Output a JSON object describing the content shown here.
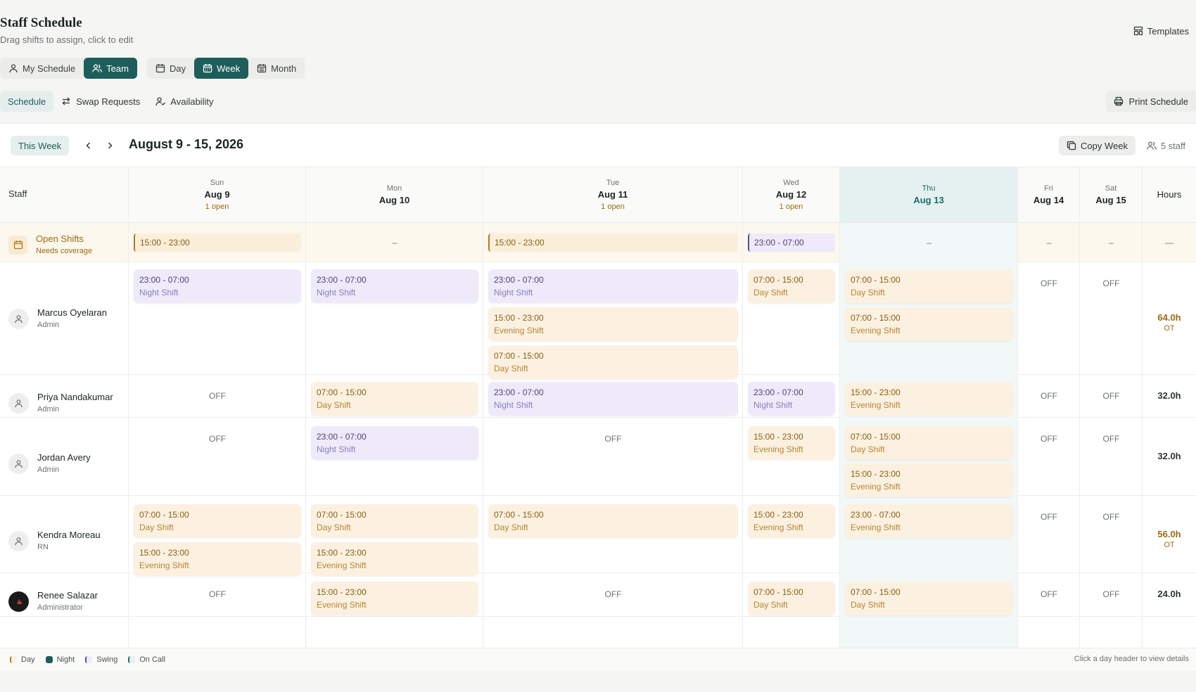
{
  "header": {
    "title": "Staff Schedule",
    "subtitle": "Drag shifts to assign, click to edit",
    "templates_label": "Templates"
  },
  "views": {
    "my_schedule": "My Schedule",
    "team": "Team",
    "day": "Day",
    "week": "Week",
    "month": "Month"
  },
  "subtabs": {
    "schedule": "Schedule",
    "swap": "Swap Requests",
    "availability": "Availability",
    "print": "Print Schedule"
  },
  "toolbar": {
    "this_week": "This Week",
    "range": "August 9 - 15, 2026",
    "copy_week": "Copy Week",
    "staff_count": "5 staff"
  },
  "grid": {
    "staff_header": "Staff",
    "hours_header": "Hours",
    "days": [
      {
        "dow": "Sun",
        "date": "Aug 9",
        "open": "1 open"
      },
      {
        "dow": "Mon",
        "date": "Aug 10",
        "open": ""
      },
      {
        "dow": "Tue",
        "date": "Aug 11",
        "open": "1 open"
      },
      {
        "dow": "Wed",
        "date": "Aug 12",
        "open": "1 open"
      },
      {
        "dow": "Thu",
        "date": "Aug 13",
        "open": ""
      },
      {
        "dow": "Fri",
        "date": "Aug 14",
        "open": ""
      },
      {
        "dow": "Sat",
        "date": "Aug 15",
        "open": ""
      }
    ],
    "open_row": {
      "name": "Open Shifts",
      "sub": "Needs coverage",
      "cells": [
        "15:00 - 23:00",
        "–",
        "15:00 - 23:00",
        "23:00 - 07:00",
        "–",
        "–",
        "–"
      ],
      "hours": "—"
    },
    "off": "OFF",
    "staff": [
      {
        "name": "Marcus Oyelaran",
        "role": "Admin",
        "hours": "64.0h",
        "ot": "OT"
      },
      {
        "name": "Priya Nandakumar",
        "role": "Admin",
        "hours": "32.0h",
        "ot": ""
      },
      {
        "name": "Jordan Avery",
        "role": "Admin",
        "hours": "32.0h",
        "ot": ""
      },
      {
        "name": "Kendra Moreau",
        "role": "RN",
        "hours": "56.0h",
        "ot": "OT"
      },
      {
        "name": "Renee Salazar",
        "role": "Administrator",
        "hours": "24.0h",
        "ot": ""
      }
    ],
    "shifts": {
      "night_time": "23:00 - 07:00",
      "night_label": "Night Shift",
      "day_time": "07:00 - 15:00",
      "day_label": "Day Shift",
      "evening_time": "15:00 - 23:00",
      "evening_label": "Evening Shift",
      "thu_evening_time": "23:00 - 07:00"
    }
  },
  "legend": {
    "day": "Day",
    "night": "Night",
    "swing": "Swing",
    "oncall": "On Call",
    "hint": "Click a day header to view details"
  },
  "colors": {
    "accent": "#1d5e5c",
    "day_bg": "#fcf1e1",
    "night_bg": "#eeeafa",
    "thu_bg": "#f1f8f7"
  }
}
